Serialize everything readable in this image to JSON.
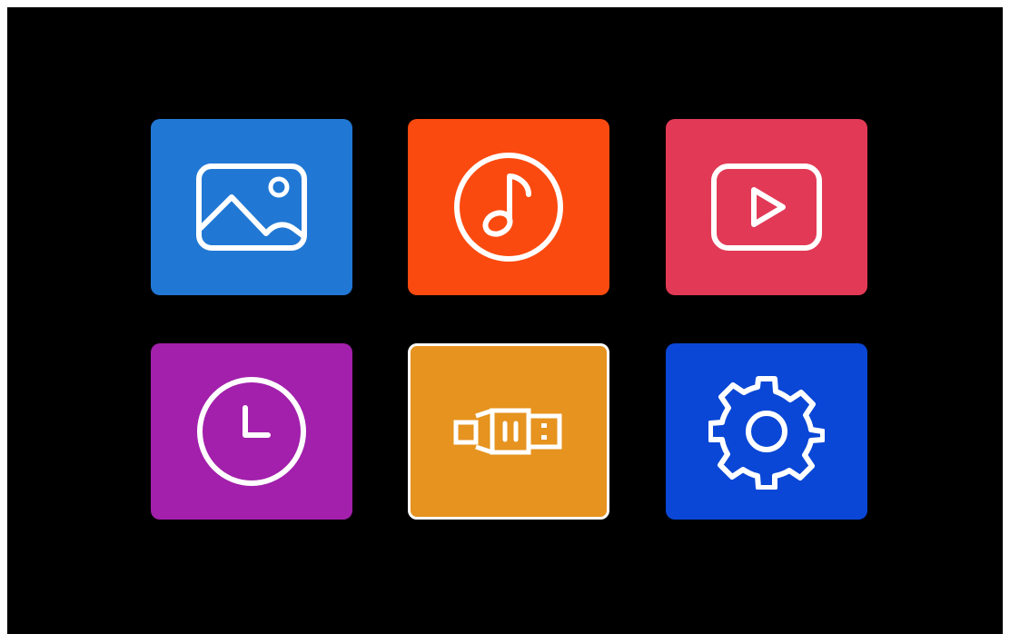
{
  "tiles": [
    {
      "icon": "picture-icon",
      "color": "#2178d4",
      "selected": false
    },
    {
      "icon": "music-note-icon",
      "color": "#fb4a0f",
      "selected": false
    },
    {
      "icon": "video-play-icon",
      "color": "#e23a56",
      "selected": false
    },
    {
      "icon": "clock-icon",
      "color": "#a220ab",
      "selected": false
    },
    {
      "icon": "usb-icon",
      "color": "#e6931f",
      "selected": true
    },
    {
      "icon": "gear-icon",
      "color": "#0a47d6",
      "selected": false
    }
  ],
  "theme": {
    "background": "#000000",
    "icon_stroke": "#ffffff",
    "selection_border": "#ffffff"
  }
}
